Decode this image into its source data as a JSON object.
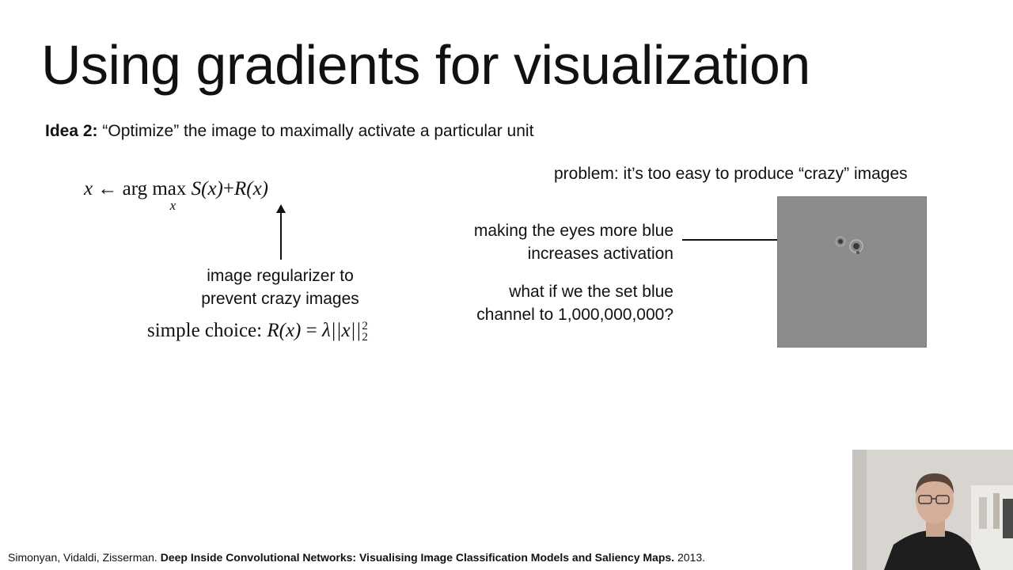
{
  "slide": {
    "title": "Using gradients for visualization",
    "idea": {
      "label": "Idea 2:",
      "text": " “Optimize” the image to maximally activate a particular unit"
    },
    "objective": {
      "lhs": "x",
      "arrow": "←",
      "op": "arg max",
      "sub": "x",
      "term1": "S(x)",
      "plus": "+",
      "term2": "R(x)"
    },
    "regularizer_caption": {
      "line1": "image regularizer to",
      "line2": "prevent crazy images"
    },
    "simple_choice": {
      "label": "simple choice:",
      "lhs": "R(x)",
      "eq": "=",
      "rhs": "λ||x||",
      "sup": "2",
      "sub": "2"
    },
    "problem": "problem: it’s too easy to produce “crazy” images",
    "eyes_caption": {
      "line1": "making the eyes more blue",
      "line2": "increases activation"
    },
    "blue_caption": {
      "line1": "what if we the set blue",
      "line2": "channel to 1,000,000,000?"
    },
    "footer": {
      "authors": "Simonyan, Vidaldi, Zisserman. ",
      "paper": "Deep Inside Convolutional Networks: Visualising Image Classification Models and Saliency Maps.",
      "year": " 2013."
    }
  },
  "colors": {
    "background": "#ffffff",
    "text": "#111111",
    "viz_gray": "#8c8c8c"
  }
}
